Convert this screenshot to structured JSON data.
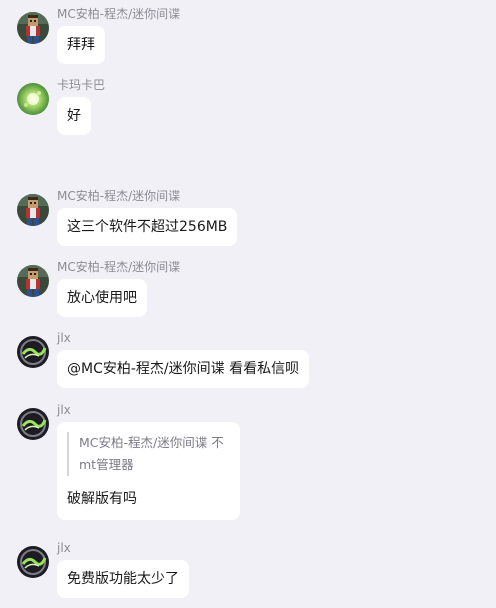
{
  "messages": [
    {
      "sender": "MC安柏-程杰/迷你间谍",
      "text": "拜拜",
      "avatar": "minecraft-character-avatar"
    },
    {
      "sender": "卡玛卡巴",
      "text": "好",
      "avatar": "green-glow-avatar"
    },
    {
      "sender": "MC安柏-程杰/迷你间谍",
      "text": "这三个软件不超过256MB",
      "avatar": "minecraft-character-avatar"
    },
    {
      "sender": "MC安柏-程杰/迷你间谍",
      "text": "放心使用吧",
      "avatar": "minecraft-character-avatar"
    },
    {
      "sender": "jlx",
      "text": "@MC安柏-程杰/迷你间谍 看看私信呗",
      "avatar": "dark-logo-avatar"
    },
    {
      "sender": "jlx",
      "quote": "MC安柏-程杰/迷你间谍 不 mt管理器",
      "text": "破解版有吗",
      "avatar": "dark-logo-avatar"
    },
    {
      "sender": "jlx",
      "text": "免费版功能太少了",
      "avatar": "dark-logo-avatar"
    }
  ],
  "colors": {
    "background": "#f1f0f6",
    "bubble": "#ffffff",
    "sender_text": "#8d8b94",
    "message_text": "#1a1a1a"
  }
}
